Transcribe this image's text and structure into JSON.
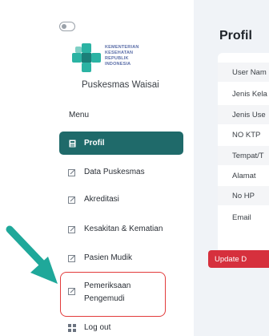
{
  "sidebar": {
    "logo_lines": [
      "KEMENTERIAN",
      "KESEHATAN",
      "REPUBLIK",
      "INDONESIA"
    ],
    "org_name": "Puskesmas Waisai",
    "menu_heading": "Menu",
    "items": [
      {
        "label": "Profil",
        "icon": "id-card-icon",
        "active": true
      },
      {
        "label": "Data Puskesmas",
        "icon": "edit-icon",
        "active": false
      },
      {
        "label": "Akreditasi",
        "icon": "edit-icon",
        "active": false
      },
      {
        "label": "Kesakitan & Kematian",
        "icon": "edit-icon",
        "active": false
      },
      {
        "label": "Pasien Mudik",
        "icon": "edit-icon",
        "active": false
      },
      {
        "label_line1": "Pemeriksaan",
        "label_line2": "Pengemudi",
        "icon": "edit-icon",
        "active": false,
        "highlighted": true
      },
      {
        "label": "Log out",
        "icon": "grid-icon",
        "active": false
      }
    ]
  },
  "content": {
    "title": "Profil",
    "fields": [
      "User Nam",
      "Jenis Kela",
      "Jenis Use",
      "NO KTP",
      "Tempat/T",
      "Alamat",
      "No HP",
      "Email"
    ],
    "update_button": "Update D"
  },
  "colors": {
    "active_bg": "#1f6a6a",
    "arrow": "#1fa89a",
    "highlight_border": "#e23b3b",
    "update_button": "#d6303d"
  }
}
